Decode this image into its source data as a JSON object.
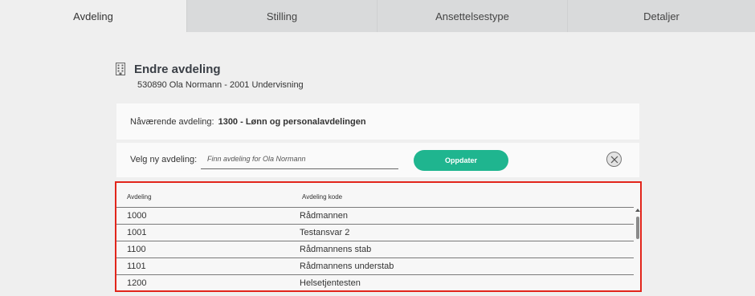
{
  "tabs": [
    {
      "label": "Avdeling",
      "active": true
    },
    {
      "label": "Stilling",
      "active": false
    },
    {
      "label": "Ansettelsestype",
      "active": false
    },
    {
      "label": "Detaljer",
      "active": false
    }
  ],
  "header": {
    "icon": "building-icon",
    "title": "Endre avdeling",
    "subtitle": "530890 Ola Normann - 2001 Undervisning"
  },
  "current": {
    "label": "Nåværende avdeling:",
    "value": "1300 - Lønn og personalavdelingen"
  },
  "new_department": {
    "label": "Velg ny avdeling:",
    "search_placeholder": "Finn avdeling for Ola Normann",
    "search_value": "",
    "update_button": "Oppdater",
    "close_icon": "close-icon"
  },
  "table": {
    "columns": [
      "Avdeling",
      "Avdeling kode"
    ],
    "rows": [
      [
        "1000",
        "Rådmannen"
      ],
      [
        "1001",
        "Testansvar 2"
      ],
      [
        "1100",
        "Rådmannens stab"
      ],
      [
        "1101",
        "Rådmannens understab"
      ],
      [
        "1200",
        "Helsetjentesten"
      ]
    ]
  },
  "colors": {
    "accent": "#1fb58f",
    "highlight_border": "#e2251b"
  }
}
